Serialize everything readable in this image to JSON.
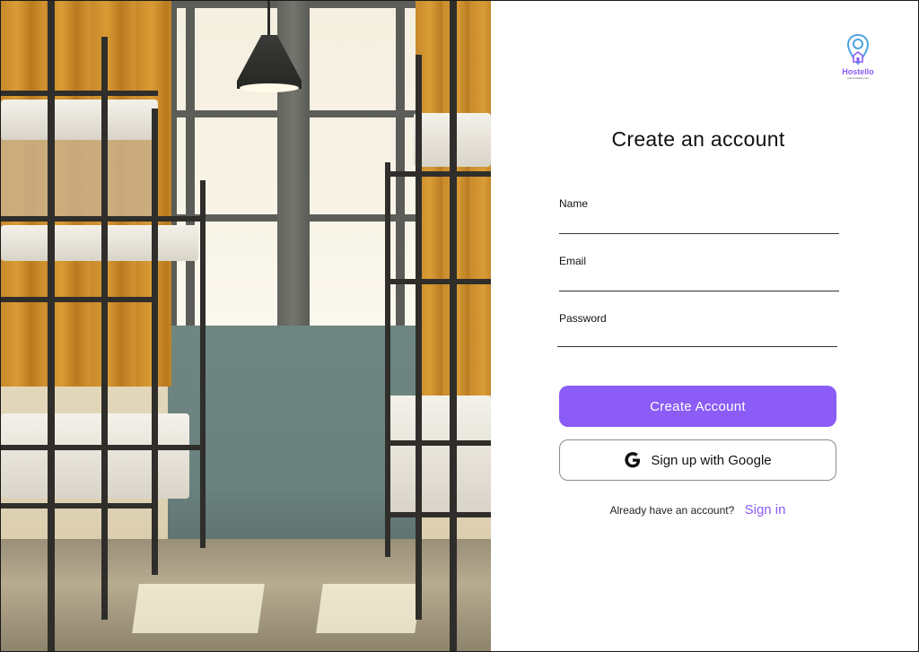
{
  "brand": {
    "name": "Hostello",
    "tagline": "www.hostello.com",
    "accent_color": "#8b5cf6",
    "logo_icon": "location-pin-house-icon"
  },
  "form": {
    "title": "Create an account",
    "name_label": "Name",
    "name_value": "",
    "email_label": "Email",
    "email_value": "",
    "password_label": "Password",
    "password_value": "",
    "create_button_label": "Create Account",
    "google_button_label": "Sign up with Google",
    "google_icon": "google-g-icon",
    "signin_prompt": "Already have an account?",
    "signin_link": "Sign in"
  },
  "hero_image": {
    "subject": "hostel-dormitory-bunk-beds-photo"
  }
}
